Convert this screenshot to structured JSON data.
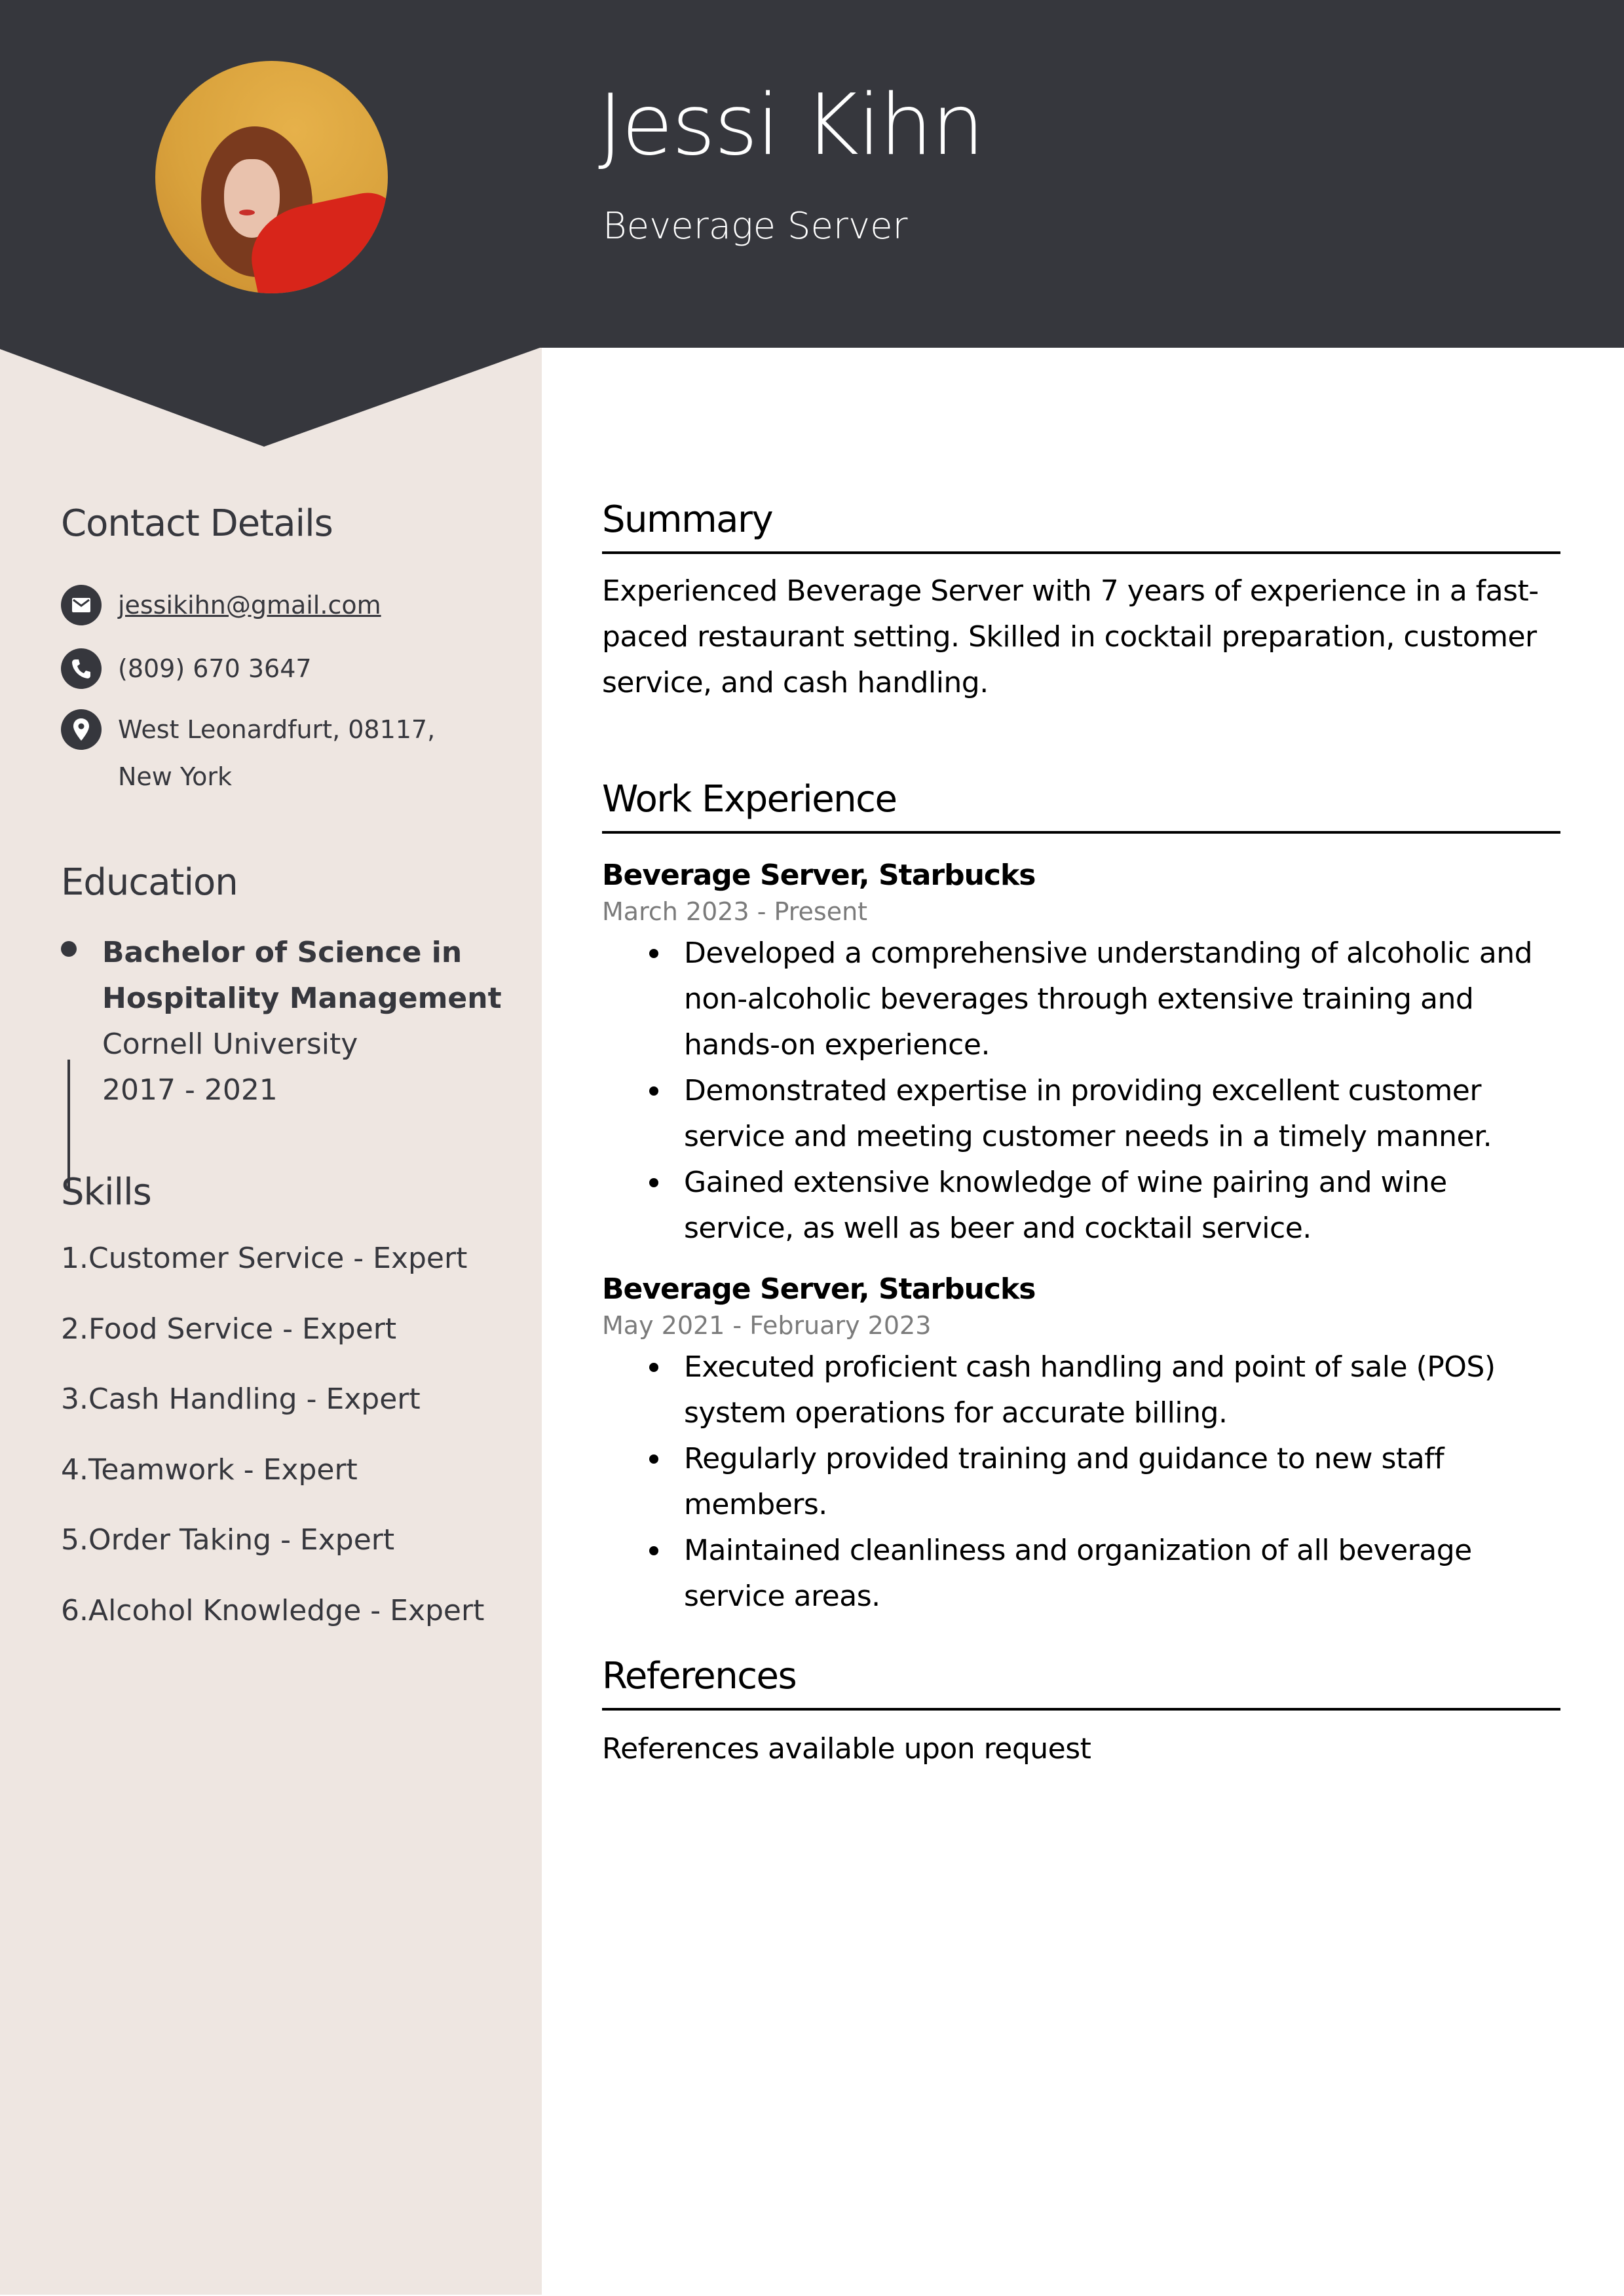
{
  "header": {
    "name": "Jessi Kihn",
    "job_title": "Beverage Server",
    "photo_alt": "profile-photo"
  },
  "colors": {
    "header_bg": "#36373d",
    "sidebar_bg": "#eee6e1",
    "text_dark": "#36373d",
    "date_gray": "#7b7b7b"
  },
  "sidebar": {
    "contact": {
      "heading": "Contact Details",
      "items": [
        {
          "icon": "envelope-icon",
          "text": "jessikihn@gmail.com"
        },
        {
          "icon": "phone-icon",
          "text": "(809) 670 3647"
        },
        {
          "icon": "location-pin-icon",
          "text": "West Leonardfurt, 08117, New York"
        }
      ]
    },
    "education": {
      "heading": "Education",
      "degree": "Bachelor of Science in Hospitality Management",
      "school": "Cornell University",
      "years": "2017 - 2021"
    },
    "skills": {
      "heading": "Skills",
      "items": [
        "1.Customer Service - Expert",
        "2.Food Service - Expert",
        "3.Cash Handling - Expert",
        "4.Teamwork - Expert",
        "5.Order Taking - Expert",
        "6.Alcohol Knowledge - Expert"
      ]
    }
  },
  "main": {
    "summary": {
      "heading": "Summary",
      "text": "Experienced Beverage Server with 7 years of experience in a fast-paced restaurant setting. Skilled in cocktail preparation, customer service, and cash handling."
    },
    "work": {
      "heading": "Work Experience",
      "jobs": [
        {
          "title": "Beverage Server, Starbucks",
          "dates": "March 2023 - Present",
          "bullets": [
            "Developed a comprehensive understanding of alcoholic and non-alcoholic beverages through extensive training and hands-on experience.",
            "Demonstrated expertise in providing excellent customer service and meeting customer needs in a timely manner.",
            "Gained extensive knowledge of wine pairing and wine service, as well as beer and cocktail service."
          ]
        },
        {
          "title": "Beverage Server, Starbucks",
          "dates": "May 2021 - February 2023",
          "bullets": [
            "Executed proficient cash handling and point of sale (POS) system operations for accurate billing.",
            "Regularly provided training and guidance to new staff members.",
            "Maintained cleanliness and organization of all beverage service areas."
          ]
        }
      ]
    },
    "references": {
      "heading": "References",
      "text": "References available upon request"
    }
  }
}
